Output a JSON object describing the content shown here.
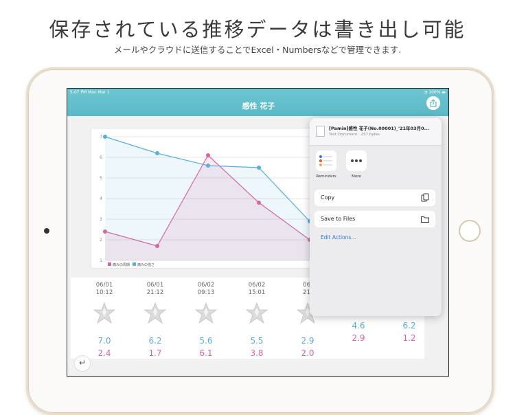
{
  "promo": {
    "headline": "保存されている推移データは書き出し可能",
    "subline": "メールやクラウドに送信することでExcel・Numbersなどで管理できます."
  },
  "status_bar": {
    "time_date": "5:07 PM  Mon Mar 1",
    "battery": "100%"
  },
  "navbar": {
    "title": "感性 花子",
    "share_icon": "share-icon"
  },
  "colors": {
    "accent": "#5bb9c6",
    "series_blue": "#58aedc",
    "series_pink": "#e2609e",
    "link": "#2f7bd8"
  },
  "chart_data": {
    "type": "line",
    "x": [
      "06/01 10:12",
      "06/01 21:12",
      "06/02 09:13",
      "06/02 15:01",
      "06/02 21",
      "",
      ""
    ],
    "ylim": [
      1,
      7
    ],
    "yticks": [
      "1",
      "2",
      "3",
      "4",
      "5",
      "6",
      "7"
    ],
    "grid": true,
    "legend_position": "bottom-left",
    "series": [
      {
        "name": "痛みの周期",
        "color": "#e2609e",
        "values": [
          2.4,
          1.7,
          6.1,
          3.8,
          2.0
        ]
      },
      {
        "name": "痛みの強さ",
        "color": "#58aedc",
        "values": [
          7.0,
          6.2,
          5.6,
          5.5,
          2.9
        ]
      }
    ]
  },
  "table": {
    "columns": [
      {
        "date": "06/01",
        "time": "10:12",
        "v1": "7.0",
        "v2": "2.4"
      },
      {
        "date": "06/01",
        "time": "21:12",
        "v1": "6.2",
        "v2": "1.7"
      },
      {
        "date": "06/02",
        "time": "09:13",
        "v1": "5.6",
        "v2": "6.1"
      },
      {
        "date": "06/02",
        "time": "15:01",
        "v1": "5.5",
        "v2": "3.8"
      },
      {
        "date": "06/",
        "time": "21:",
        "v1": "2.9",
        "v2": "2.0"
      },
      {
        "date": "",
        "time": "",
        "v1": "4.6",
        "v2": "2.9"
      },
      {
        "date": "",
        "time": "",
        "v1": "6.2",
        "v2": "1.2"
      }
    ],
    "back_icon": "return-icon"
  },
  "share_sheet": {
    "doc_title": "[Pamin]感性 花子(No.00001)_'21年03月0...",
    "doc_subtitle": "Text Document · 257 bytes",
    "apps": [
      {
        "label": "Reminders",
        "icon": "reminders-icon"
      },
      {
        "label": "More",
        "icon": "more-icon"
      }
    ],
    "actions": [
      {
        "label": "Copy",
        "icon": "copy-icon"
      },
      {
        "label": "Save to Files",
        "icon": "folder-icon"
      }
    ],
    "edit_actions": "Edit Actions..."
  }
}
